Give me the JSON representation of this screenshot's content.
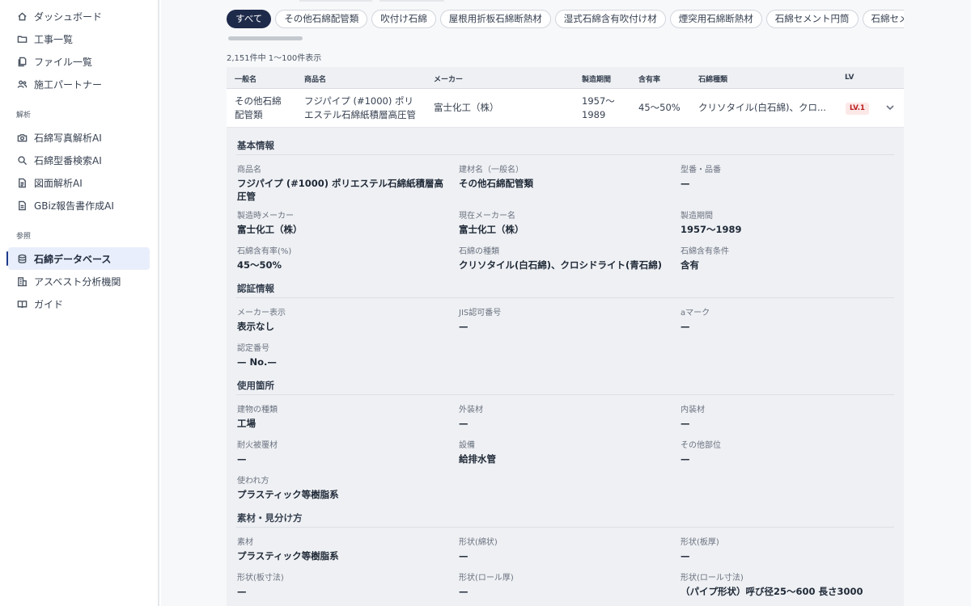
{
  "sidebar": {
    "items": [
      {
        "label": "ダッシュボード",
        "icon": "home-icon"
      },
      {
        "label": "工事一覧",
        "icon": "folder-icon"
      },
      {
        "label": "ファイル一覧",
        "icon": "files-icon"
      },
      {
        "label": "施工パートナー",
        "icon": "users-icon"
      }
    ],
    "section_analysis": "解析",
    "analysis_items": [
      {
        "label": "石綿写真解析AI",
        "icon": "camera-icon"
      },
      {
        "label": "石綿型番検索AI",
        "icon": "search-icon"
      },
      {
        "label": "図面解析AI",
        "icon": "document-icon"
      },
      {
        "label": "GBiz報告書作成AI",
        "icon": "report-icon"
      }
    ],
    "section_reference": "参照",
    "reference_items": [
      {
        "label": "石綿データベース",
        "icon": "database-icon",
        "active": true
      },
      {
        "label": "アスベスト分析機関",
        "icon": "building-icon"
      },
      {
        "label": "ガイド",
        "icon": "book-icon"
      }
    ]
  },
  "filters": [
    "すべて",
    "その他石綿配管類",
    "吹付け石綿",
    "屋根用折板石綿断熱材",
    "湿式石綿含有吹付け材",
    "煙突用石綿断熱材",
    "石綿セメント円筒",
    "石綿セメ"
  ],
  "count_text": "2,151件中 1〜100件表示",
  "table": {
    "headers": {
      "general_name": "一般名",
      "product_name": "商品名",
      "maker": "メーカー",
      "period": "製造期間",
      "content": "含有率",
      "asbestos_type": "石綿種類",
      "lv": "LV"
    },
    "row": {
      "general_name_1": "その他石綿",
      "general_name_2": "配管類",
      "product_name_1": "フジパイプ (#1000) ポリ",
      "product_name_2": "エステル石綿紙積層高圧管",
      "maker": "富士化工（株）",
      "period_1": "1957〜",
      "period_2": "1989",
      "content": "45〜50%",
      "asbestos_type": "クリソタイル(白石綿)、クロ...",
      "lv": "LV.1"
    }
  },
  "detail": {
    "basic": {
      "title": "基本情報",
      "fields": [
        {
          "label": "商品名",
          "value": "フジパイプ (#1000) ポリエステル石綿紙積層高圧管"
        },
        {
          "label": "建材名（一般名）",
          "value": "その他石綿配管類"
        },
        {
          "label": "型番・品番",
          "value": "—"
        },
        {
          "label": "製造時メーカー",
          "value": "富士化工（株）"
        },
        {
          "label": "現在メーカー名",
          "value": "富士化工（株）"
        },
        {
          "label": "製造期間",
          "value": "1957〜1989"
        },
        {
          "label": "石綿含有率(%)",
          "value": "45〜50%"
        },
        {
          "label": "石綿の種類",
          "value": "クリソタイル(白石綿)、クロシドライト(青石綿)"
        },
        {
          "label": "石綿含有条件",
          "value": "含有"
        }
      ]
    },
    "cert": {
      "title": "認証情報",
      "fields": [
        {
          "label": "メーカー表示",
          "value": "表示なし"
        },
        {
          "label": "JIS認可番号",
          "value": "—"
        },
        {
          "label": "aマーク",
          "value": "—"
        },
        {
          "label": "認定番号",
          "value": "— No.—"
        }
      ]
    },
    "usage": {
      "title": "使用箇所",
      "fields": [
        {
          "label": "建物の種類",
          "value": "工場"
        },
        {
          "label": "外装材",
          "value": "—"
        },
        {
          "label": "内装材",
          "value": "—"
        },
        {
          "label": "耐火被覆材",
          "value": "—"
        },
        {
          "label": "設備",
          "value": "給排水管"
        },
        {
          "label": "その他部位",
          "value": "—"
        },
        {
          "label": "使われ方",
          "value": "プラスティック等樹脂系"
        }
      ]
    },
    "material": {
      "title": "素材・見分け方",
      "fields": [
        {
          "label": "素材",
          "value": "プラスティック等樹脂系"
        },
        {
          "label": "形状(綿状)",
          "value": "—"
        },
        {
          "label": "形状(板厚)",
          "value": "—"
        },
        {
          "label": "形状(板寸法)",
          "value": "—"
        },
        {
          "label": "形状(ロール厚)",
          "value": "—"
        },
        {
          "label": "形状(ロール寸法)",
          "value": "（パイプ形状）呼び径25〜600 長さ3000"
        }
      ]
    }
  }
}
